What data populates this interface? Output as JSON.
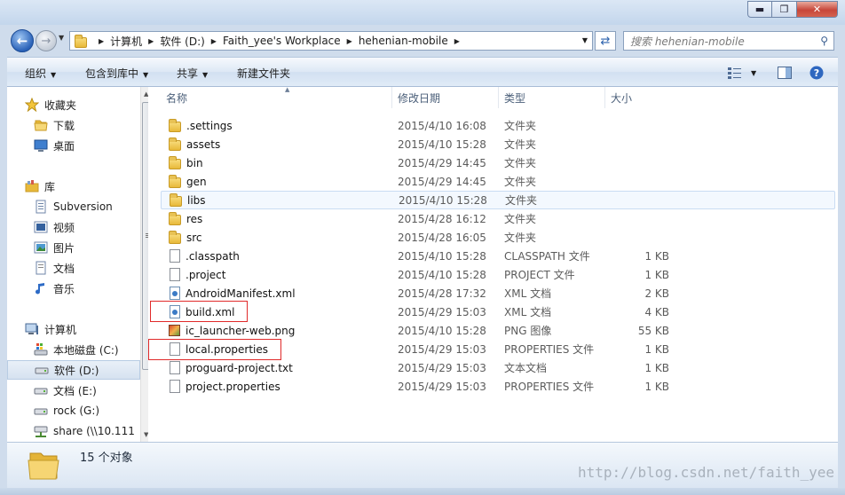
{
  "window": {
    "minimize_glyph": "▬",
    "maximize_glyph": "❐",
    "close_glyph": "✕"
  },
  "address": {
    "breadcrumbs": [
      "计算机",
      "软件 (D:)",
      "Faith_yee's Workplace",
      "hehenian-mobile"
    ],
    "search_placeholder": "搜索 hehenian-mobile"
  },
  "toolbar": {
    "organize": "组织",
    "include_in_library": "包含到库中",
    "share": "共享",
    "new_folder": "新建文件夹"
  },
  "sidebar": {
    "items": [
      {
        "label": "收藏夹",
        "icon": "star-icon",
        "indent": 0
      },
      {
        "label": "下载",
        "icon": "folder-icon",
        "indent": 1
      },
      {
        "label": "桌面",
        "icon": "desktop-icon",
        "indent": 1
      },
      {
        "label": "库",
        "icon": "library-icon",
        "indent": 0
      },
      {
        "label": "Subversion",
        "icon": "library-doc-icon",
        "indent": 1
      },
      {
        "label": "视频",
        "icon": "video-icon",
        "indent": 1
      },
      {
        "label": "图片",
        "icon": "picture-icon",
        "indent": 1
      },
      {
        "label": "文档",
        "icon": "document-icon",
        "indent": 1
      },
      {
        "label": "音乐",
        "icon": "music-icon",
        "indent": 1
      },
      {
        "label": "计算机",
        "icon": "computer-icon",
        "indent": 0
      },
      {
        "label": "本地磁盘 (C:)",
        "icon": "windows-drive-icon",
        "indent": 1
      },
      {
        "label": "软件 (D:)",
        "icon": "drive-icon",
        "indent": 1
      },
      {
        "label": "文档 (E:)",
        "icon": "drive-icon",
        "indent": 1
      },
      {
        "label": "rock (G:)",
        "icon": "drive-icon",
        "indent": 1
      },
      {
        "label": "share (\\\\10.111",
        "icon": "network-drive-icon",
        "indent": 1
      }
    ]
  },
  "columns": {
    "name": "名称",
    "date": "修改日期",
    "type": "类型",
    "size": "大小"
  },
  "files": [
    {
      "name": ".settings",
      "date": "2015/4/10 16:08",
      "type": "文件夹",
      "size": "",
      "icon": "folder"
    },
    {
      "name": "assets",
      "date": "2015/4/10 15:28",
      "type": "文件夹",
      "size": "",
      "icon": "folder"
    },
    {
      "name": "bin",
      "date": "2015/4/29 14:45",
      "type": "文件夹",
      "size": "",
      "icon": "folder"
    },
    {
      "name": "gen",
      "date": "2015/4/29 14:45",
      "type": "文件夹",
      "size": "",
      "icon": "folder"
    },
    {
      "name": "libs",
      "date": "2015/4/10 15:28",
      "type": "文件夹",
      "size": "",
      "icon": "folder"
    },
    {
      "name": "res",
      "date": "2015/4/28 16:12",
      "type": "文件夹",
      "size": "",
      "icon": "folder"
    },
    {
      "name": "src",
      "date": "2015/4/28 16:05",
      "type": "文件夹",
      "size": "",
      "icon": "folder"
    },
    {
      "name": ".classpath",
      "date": "2015/4/10 15:28",
      "type": "CLASSPATH 文件",
      "size": "1 KB",
      "icon": "doc"
    },
    {
      "name": ".project",
      "date": "2015/4/10 15:28",
      "type": "PROJECT 文件",
      "size": "1 KB",
      "icon": "doc"
    },
    {
      "name": "AndroidManifest.xml",
      "date": "2015/4/28 17:32",
      "type": "XML 文档",
      "size": "2 KB",
      "icon": "xml"
    },
    {
      "name": "build.xml",
      "date": "2015/4/29 15:03",
      "type": "XML 文档",
      "size": "4 KB",
      "icon": "xml"
    },
    {
      "name": "ic_launcher-web.png",
      "date": "2015/4/10 15:28",
      "type": "PNG 图像",
      "size": "55 KB",
      "icon": "png"
    },
    {
      "name": "local.properties",
      "date": "2015/4/29 15:03",
      "type": "PROPERTIES 文件",
      "size": "1 KB",
      "icon": "doc"
    },
    {
      "name": "proguard-project.txt",
      "date": "2015/4/29 15:03",
      "type": "文本文档",
      "size": "1 KB",
      "icon": "doc"
    },
    {
      "name": "project.properties",
      "date": "2015/4/29 15:03",
      "type": "PROPERTIES 文件",
      "size": "1 KB",
      "icon": "doc"
    }
  ],
  "status": {
    "item_count": "15 个对象"
  },
  "watermark": "http://blog.csdn.net/faith_yee",
  "colors": {
    "highlight_box": "#e02a2a",
    "selection": "#d6e2f0"
  }
}
